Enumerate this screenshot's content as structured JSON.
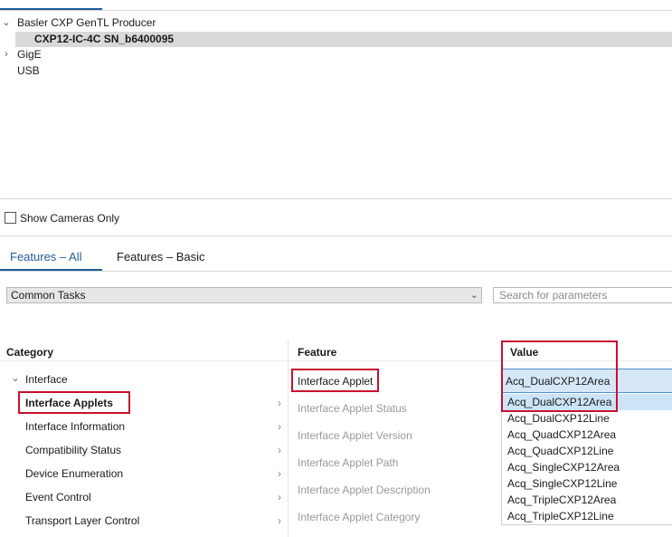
{
  "device_tree": {
    "items": [
      {
        "label": "Basler CXP GenTL Producer",
        "expanded": true
      },
      {
        "label": "CXP12-IC-4C SN_b6400095",
        "selected": true
      },
      {
        "label": "GigE",
        "expanded": false
      },
      {
        "label": "USB"
      }
    ]
  },
  "show_cameras_only": {
    "label": "Show Cameras Only",
    "checked": false
  },
  "tabs": [
    {
      "label": "Features – All",
      "active": true
    },
    {
      "label": "Features – Basic",
      "active": false
    }
  ],
  "filter": {
    "selected": "Common Tasks"
  },
  "search": {
    "placeholder": "Search for parameters"
  },
  "category_panel": {
    "header": "Category",
    "root": "Interface",
    "items": [
      "Interface Applets",
      "Interface Information",
      "Compatibility Status",
      "Device Enumeration",
      "Event Control",
      "Transport Layer Control"
    ]
  },
  "feature_panel": {
    "header": "Feature",
    "items": [
      "Interface Applet",
      "Interface Applet Status",
      "Interface Applet Version",
      "Interface Applet Path",
      "Interface Applet Description",
      "Interface Applet Category"
    ]
  },
  "value_panel": {
    "header": "Value",
    "current": "Acq_DualCXP12Area",
    "options": [
      "Acq_DualCXP12Area",
      "Acq_DualCXP12Line",
      "Acq_QuadCXP12Area",
      "Acq_QuadCXP12Line",
      "Acq_SingleCXP12Area",
      "Acq_SingleCXP12Line",
      "Acq_TripleCXP12Area",
      "Acq_TripleCXP12Line"
    ]
  },
  "colors": {
    "accent": "#1f5b99",
    "highlight_box": "#c8102e",
    "selection": "#d6e8f7"
  }
}
